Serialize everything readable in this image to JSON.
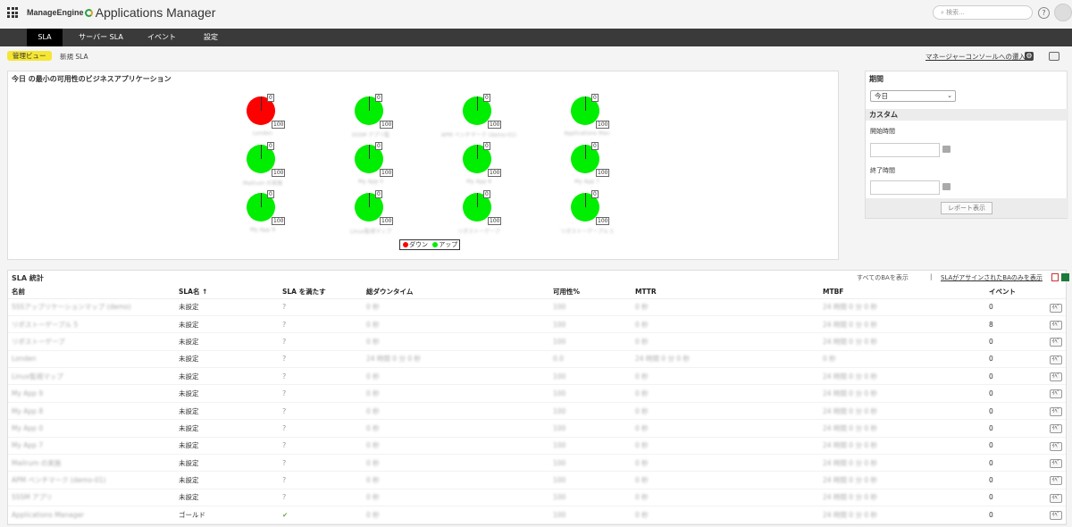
{
  "header": {
    "brand_company": "ManageEngine",
    "brand_product": "Applications Manager",
    "search_placeholder": "検索...",
    "help_label": "?"
  },
  "nav": {
    "tabs": [
      {
        "label": "SLA"
      },
      {
        "label": "サーバー SLA"
      },
      {
        "label": "イベント"
      },
      {
        "label": "設定"
      }
    ]
  },
  "subnav": {
    "admin_view": "管理ビュー",
    "new_sla": "新規 SLA",
    "console_link": "マネージャーコンソールへの遷入"
  },
  "availability": {
    "title": "今日 の最小の可用性のビジネスアプリケーション",
    "apps": [
      {
        "name": "Londen",
        "down": 100,
        "up": 0
      },
      {
        "name": "SSSM アプリ監",
        "down": 0,
        "up": 100
      },
      {
        "name": "APM ベンチマーク (demo-01)",
        "down": 0,
        "up": 100
      },
      {
        "name": "Applications Man",
        "down": 0,
        "up": 100
      },
      {
        "name": "Mailrum の実施",
        "down": 0,
        "up": 100
      },
      {
        "name": "My App 0",
        "down": 0,
        "up": 100
      },
      {
        "name": "My App 8",
        "down": 0,
        "up": 100
      },
      {
        "name": "My App 7",
        "down": 0,
        "up": 100
      },
      {
        "name": "My App 9",
        "down": 0,
        "up": 100
      },
      {
        "name": "Linux監視マップ",
        "down": 0,
        "up": 100
      },
      {
        "name": "リポストーゲープ",
        "down": 0,
        "up": 100
      },
      {
        "name": "リポストーゲープル 5",
        "down": 0,
        "up": 100
      }
    ],
    "zero_label": "0",
    "hundred_label": "100",
    "legend": {
      "down": "ダウン",
      "up": "アップ"
    },
    "colors": {
      "down": "#ff0000",
      "up": "#00ee00"
    }
  },
  "period_panel": {
    "title": "期間",
    "selected": "今日",
    "custom_title": "カスタム",
    "start_label": "開始時間",
    "end_label": "終了時間",
    "report_button": "レポート表示"
  },
  "stats": {
    "title": "SLA 統計",
    "show_all": "すべてのBAを表示",
    "separator": "|",
    "show_assigned": "SLAがアサインされたBAのみを表示",
    "columns": [
      "名前",
      "SLA名 ↑",
      "SLA を満たす",
      "総ダウンタイム",
      "可用性%",
      "MTTR",
      "MTBF",
      "イベント"
    ],
    "rows": [
      {
        "name": "SSSアップリケーションマップ (demo)",
        "sla": "未設定",
        "meets": "?",
        "downtime": "0 秒",
        "avail": "100",
        "mttr": "0 秒",
        "mtbf": "24 時間 0 分 0 秒",
        "events": "0"
      },
      {
        "name": "リポストーゲープル 5",
        "sla": "未設定",
        "meets": "?",
        "downtime": "0 秒",
        "avail": "100",
        "mttr": "0 秒",
        "mtbf": "24 時間 0 分 0 秒",
        "events": "8"
      },
      {
        "name": "リポストーゲープ",
        "sla": "未設定",
        "meets": "?",
        "downtime": "0 秒",
        "avail": "100",
        "mttr": "0 秒",
        "mtbf": "24 時間 0 分 0 秒",
        "events": "0"
      },
      {
        "name": "Londen",
        "sla": "未設定",
        "meets": "?",
        "downtime": "24 時間 0 分 0 秒",
        "avail": "0.0",
        "mttr": "24 時間 0 分 0 秒",
        "mtbf": "0 秒",
        "events": "0"
      },
      {
        "name": "Linux監視マップ",
        "sla": "未設定",
        "meets": "?",
        "downtime": "0 秒",
        "avail": "100",
        "mttr": "0 秒",
        "mtbf": "24 時間 0 分 0 秒",
        "events": "0"
      },
      {
        "name": "My App 9",
        "sla": "未設定",
        "meets": "?",
        "downtime": "0 秒",
        "avail": "100",
        "mttr": "0 秒",
        "mtbf": "24 時間 0 分 0 秒",
        "events": "0"
      },
      {
        "name": "My App 8",
        "sla": "未設定",
        "meets": "?",
        "downtime": "0 秒",
        "avail": "100",
        "mttr": "0 秒",
        "mtbf": "24 時間 0 分 0 秒",
        "events": "0"
      },
      {
        "name": "My App 0",
        "sla": "未設定",
        "meets": "?",
        "downtime": "0 秒",
        "avail": "100",
        "mttr": "0 秒",
        "mtbf": "24 時間 0 分 0 秒",
        "events": "0"
      },
      {
        "name": "My App 7",
        "sla": "未設定",
        "meets": "?",
        "downtime": "0 秒",
        "avail": "100",
        "mttr": "0 秒",
        "mtbf": "24 時間 0 分 0 秒",
        "events": "0"
      },
      {
        "name": "Mailrum の実施",
        "sla": "未設定",
        "meets": "?",
        "downtime": "0 秒",
        "avail": "100",
        "mttr": "0 秒",
        "mtbf": "24 時間 0 分 0 秒",
        "events": "0"
      },
      {
        "name": "APM ベンチマーク (demo-01)",
        "sla": "未設定",
        "meets": "?",
        "downtime": "0 秒",
        "avail": "100",
        "mttr": "0 秒",
        "mtbf": "24 時間 0 分 0 秒",
        "events": "0"
      },
      {
        "name": "SSSM アプリ",
        "sla": "未設定",
        "meets": "?",
        "downtime": "0 秒",
        "avail": "100",
        "mttr": "0 秒",
        "mtbf": "24 時間 0 分 0 秒",
        "events": "0"
      },
      {
        "name": "Applications Manager",
        "sla": "ゴールド",
        "meets": "✔",
        "downtime": "0 秒",
        "avail": "100",
        "mttr": "0 秒",
        "mtbf": "24 時間 0 分 0 秒",
        "events": "0"
      }
    ],
    "event_button": "ｲﾍﾞ"
  }
}
